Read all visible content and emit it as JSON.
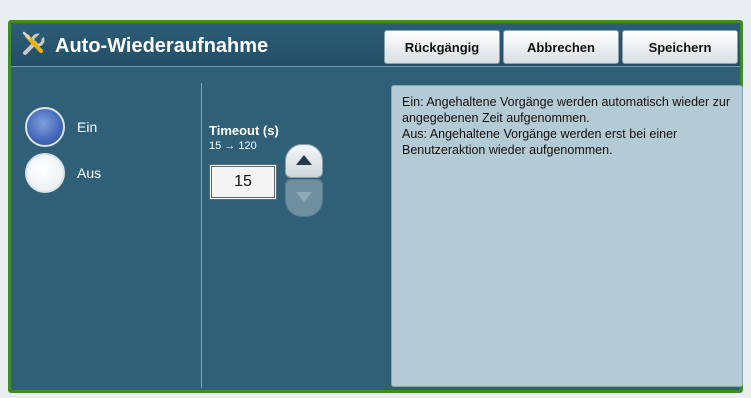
{
  "header": {
    "title": "Auto-Wiederaufnahme",
    "buttons": {
      "undo": "Rückgängig",
      "cancel": "Abbrechen",
      "save": "Speichern"
    }
  },
  "mode": {
    "options": [
      {
        "label": "Ein",
        "selected": true
      },
      {
        "label": "Aus",
        "selected": false
      }
    ]
  },
  "timeout": {
    "label": "Timeout (s)",
    "range": "15 → 120",
    "value": "15"
  },
  "info": {
    "line1": "Ein: Angehaltene Vorgänge werden automatisch wieder zur angegebenen Zeit aufgenommen.",
    "line2": "Aus: Angehaltene Vorgänge werden erst bei einer Benutzeraktion wieder aufgenommen."
  },
  "colors": {
    "panel": "#2f6078",
    "border": "#3f8a2a",
    "info_bg": "#b4cbd5",
    "radio_on": "#4466b8"
  },
  "icons": {
    "title": "tools-icon",
    "up": "arrow-up-icon",
    "down": "arrow-down-icon"
  }
}
